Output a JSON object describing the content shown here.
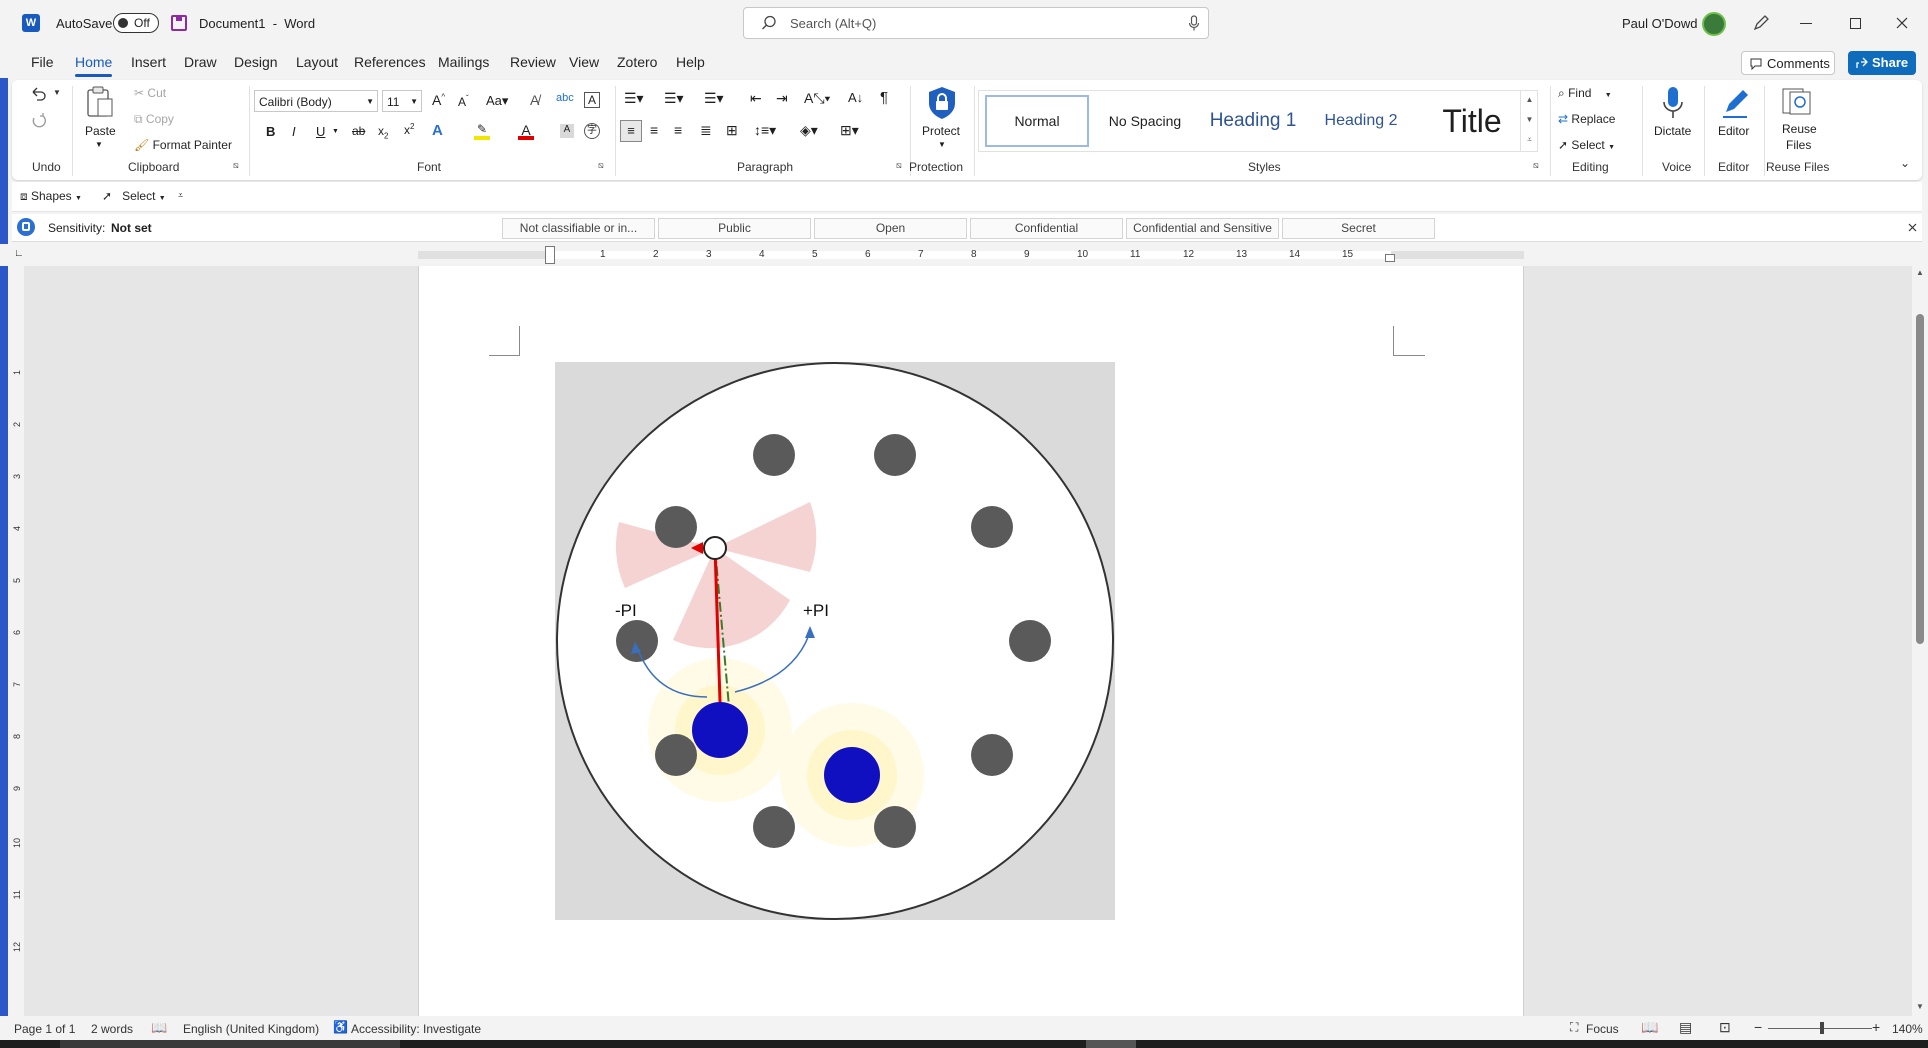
{
  "titlebar": {
    "autosave_label": "AutoSave",
    "autosave_state": "Off",
    "doc_title": "Document1  -  Word",
    "search_placeholder": "Search (Alt+Q)",
    "user_name": "Paul O'Dowd"
  },
  "tabs": [
    "File",
    "Home",
    "Insert",
    "Draw",
    "Design",
    "Layout",
    "References",
    "Mailings",
    "Review",
    "View",
    "Zotero",
    "Help"
  ],
  "active_tab": "Home",
  "actions": {
    "comments": "Comments",
    "share": "Share"
  },
  "ribbon": {
    "undo_group": "Undo",
    "clipboard": {
      "paste": "Paste",
      "cut": "Cut",
      "copy": "Copy",
      "format_painter": "Format Painter",
      "group": "Clipboard"
    },
    "font": {
      "name": "Calibri (Body)",
      "size": "11",
      "group": "Font"
    },
    "paragraph_group": "Paragraph",
    "protection": {
      "protect": "Protect",
      "group": "Protection"
    },
    "styles": {
      "items": [
        "Normal",
        "No Spacing",
        "Heading 1",
        "Heading 2",
        "Title"
      ],
      "group": "Styles"
    },
    "editing": {
      "find": "Find",
      "replace": "Replace",
      "select": "Select",
      "group": "Editing"
    },
    "voice": {
      "dictate": "Dictate",
      "group": "Voice"
    },
    "editor": {
      "editor": "Editor",
      "group": "Editor"
    },
    "reuse": {
      "label_line1": "Reuse",
      "label_line2": "Files",
      "group": "Reuse Files"
    }
  },
  "qat": {
    "shapes": "Shapes",
    "select": "Select"
  },
  "sensitivity": {
    "label": "Sensitivity:",
    "value": "Not set",
    "options": [
      "Not classifiable or in...",
      "Public",
      "Open",
      "Confidential",
      "Confidential and Sensitive",
      "Secret"
    ]
  },
  "ruler_numbers": [
    "1",
    "2",
    "3",
    "4",
    "5",
    "6",
    "7",
    "8",
    "9",
    "10",
    "11",
    "12",
    "13",
    "14",
    "15"
  ],
  "vruler_numbers": [
    "1",
    "2",
    "3",
    "4",
    "5",
    "6",
    "7",
    "8",
    "9",
    "10",
    "11",
    "12"
  ],
  "diagram": {
    "minus_label": "-PI",
    "plus_label": "+PI"
  },
  "statusbar": {
    "page": "Page 1 of 1",
    "words": "2 words",
    "language": "English (United Kingdom)",
    "accessibility": "Accessibility: Investigate",
    "focus": "Focus",
    "zoom": "140%"
  },
  "colors": {
    "accent": "#185abd",
    "share_bg": "#0f6cbd",
    "robot_blue": "#1010c0",
    "heading": "#2f5496",
    "error_red": "#e00000"
  }
}
